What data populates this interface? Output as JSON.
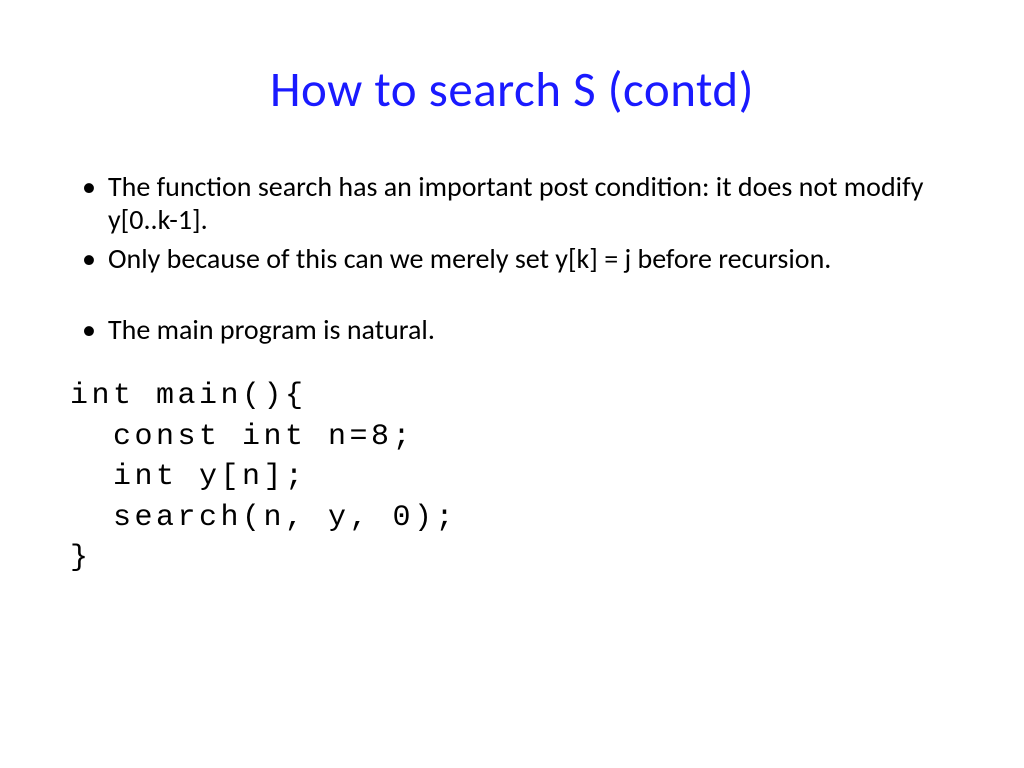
{
  "slide": {
    "title": "How to search S (contd)",
    "bullets": [
      "The function search has an important post condition: it does not modify y[0..k-1].",
      "Only because of this can we merely set y[k] = j before recursion.",
      "The main program is natural."
    ],
    "code": "int main(){\n  const int n=8;\n  int y[n];\n  search(n, y, 0);\n}"
  }
}
